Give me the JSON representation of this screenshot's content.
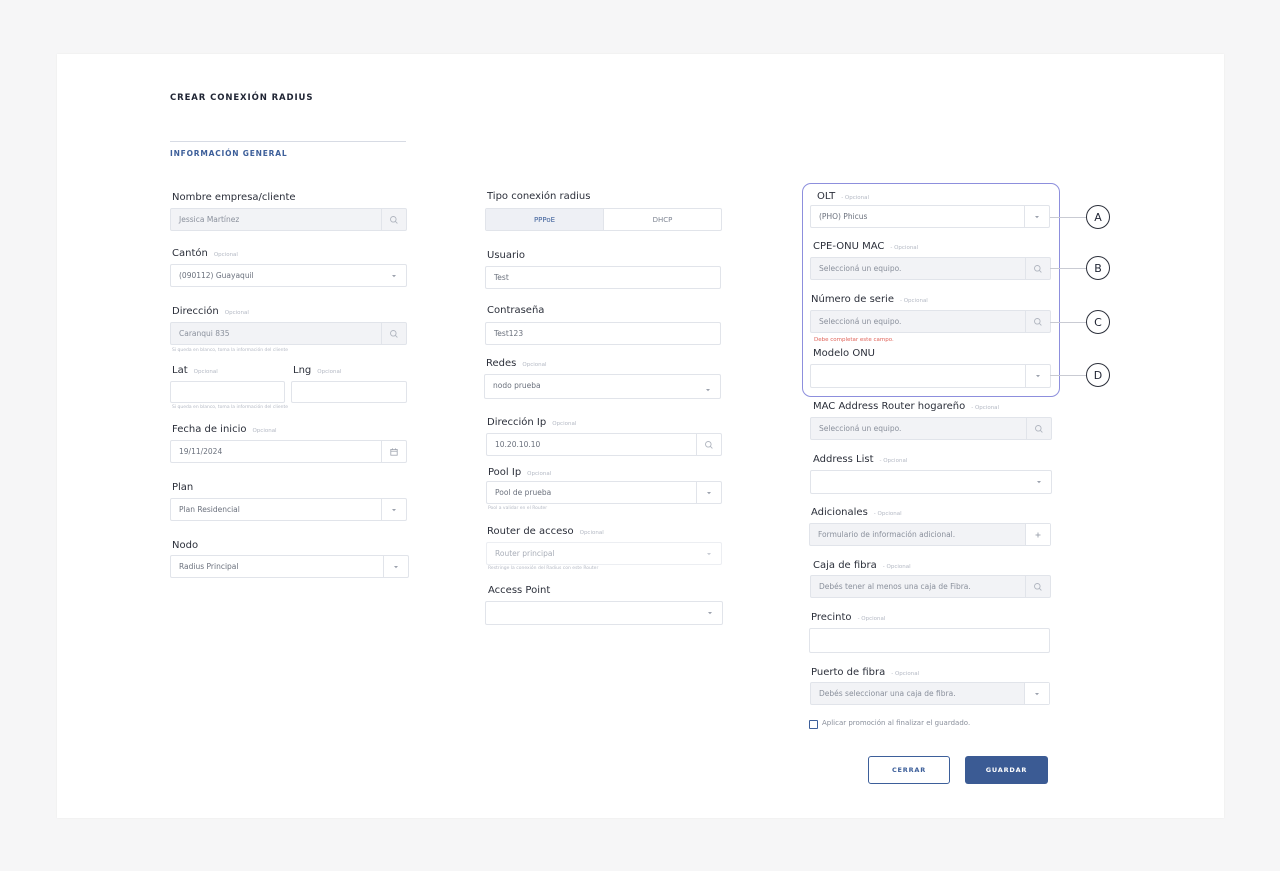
{
  "header": {
    "title": "CREAR CONEXIÓN RADIUS",
    "section": "INFORMACIÓN GENERAL"
  },
  "optional_tag": "Opcional",
  "optional_tag_dash": "- Opcional",
  "left": {
    "cliente": {
      "label": "Nombre empresa/cliente",
      "value": "Jessica Martínez"
    },
    "canton": {
      "label": "Cantón",
      "value": "(090112) Guayaquil"
    },
    "direccion": {
      "label": "Dirección",
      "value": "Caranqui 835",
      "help": "Si queda en blanco, toma la información del cliente"
    },
    "lat": {
      "label": "Lat",
      "value": ""
    },
    "lng": {
      "label": "Lng",
      "value": "",
      "help": "Si queda en blanco, toma la información del cliente"
    },
    "fecha": {
      "label": "Fecha de inicio",
      "value": "19/11/2024"
    },
    "plan": {
      "label": "Plan",
      "value": "Plan Residencial"
    },
    "nodo": {
      "label": "Nodo",
      "value": "Radius Principal"
    }
  },
  "middle": {
    "tipo": {
      "label": "Tipo conexión radius",
      "options": [
        "PPPoE",
        "DHCP"
      ],
      "selected": "PPPoE"
    },
    "usuario": {
      "label": "Usuario",
      "value": "Test"
    },
    "contrasena": {
      "label": "Contraseña",
      "value": "Test123"
    },
    "redes": {
      "label": "Redes",
      "value": "nodo prueba"
    },
    "ip": {
      "label": "Dirección Ip",
      "value": "10.20.10.10"
    },
    "pool": {
      "label": "Pool Ip",
      "value": "Pool de prueba",
      "help": "Pool a validar en el Router"
    },
    "router": {
      "label": "Router de acceso",
      "value": "Router principal",
      "help": "Restringe la conexión del Radius con este Router"
    },
    "access_point": {
      "label": "Access Point",
      "value": ""
    }
  },
  "right": {
    "olt": {
      "label": "OLT",
      "value": "(PHO) Phicus"
    },
    "cpe": {
      "label": "CPE-ONU MAC",
      "placeholder": "Seleccioná un equipo."
    },
    "serie": {
      "label": "Número de serie",
      "placeholder": "Seleccioná un equipo.",
      "error": "Debe completar este campo."
    },
    "modelo": {
      "label": "Modelo ONU",
      "value": ""
    },
    "mac_router": {
      "label": "MAC Address Router hogareño",
      "placeholder": "Seleccioná un equipo."
    },
    "address_list": {
      "label": "Address List",
      "value": ""
    },
    "adicionales": {
      "label": "Adicionales",
      "placeholder": "Formulario de información adicional."
    },
    "caja": {
      "label": "Caja de fibra",
      "placeholder": "Debés tener al menos una caja de Fibra."
    },
    "precinto": {
      "label": "Precinto",
      "value": ""
    },
    "puerto": {
      "label": "Puerto de fibra",
      "placeholder": "Debés seleccionar una caja de fibra."
    },
    "promo": {
      "label": "Aplicar promoción al finalizar el guardado.",
      "checked": false
    }
  },
  "callouts": [
    "A",
    "B",
    "C",
    "D"
  ],
  "actions": {
    "cancel": "CERRAR",
    "save": "GUARDAR"
  },
  "colors": {
    "accent": "#3b5b94",
    "highlight": "#8d8fdd",
    "error": "#e0645a"
  },
  "icons": {
    "search": "search-icon",
    "dropdown": "chevron-down-icon",
    "calendar": "calendar-icon",
    "add": "plus-icon"
  }
}
